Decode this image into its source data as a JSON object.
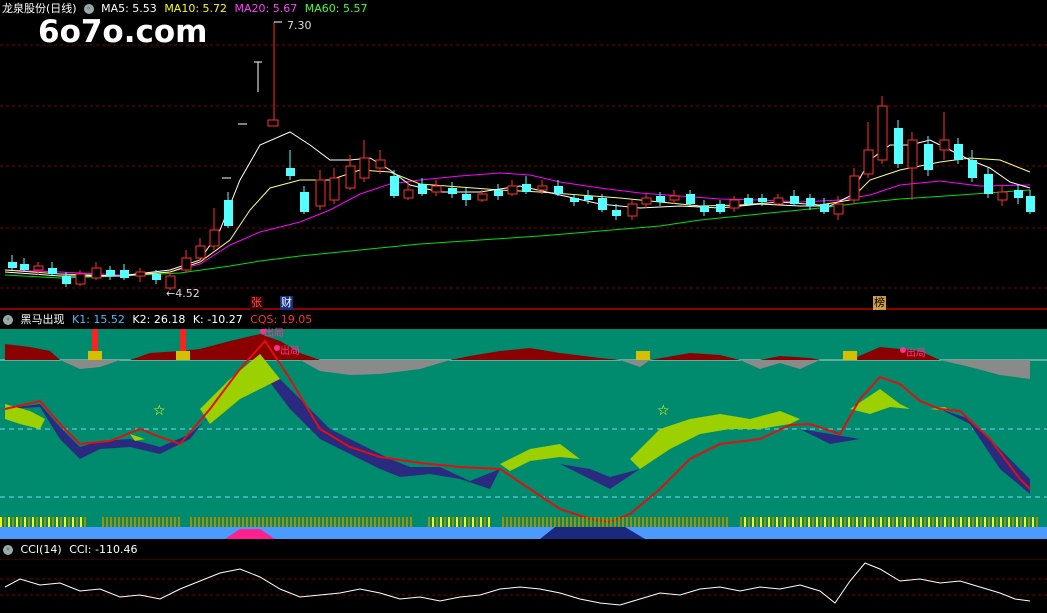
{
  "window_title": "龙泉股份(日线)",
  "watermark": "6o7o.com",
  "main_panel": {
    "indicators": [
      {
        "label": "MA5: 5.53",
        "color": "#ffffff"
      },
      {
        "label": "MA10: 5.72",
        "color": "#ffff00"
      },
      {
        "label": "MA20: 5.67",
        "color": "#ff00ff"
      },
      {
        "label": "MA60: 5.57",
        "color": "#00ff00"
      }
    ],
    "high_label": "7.30",
    "low_label": "4.52",
    "badges": [
      {
        "text": "张",
        "color": "#ff4444",
        "bg": "#400000"
      },
      {
        "text": "财",
        "color": "#ffffff",
        "bg": "#203080"
      },
      {
        "text": "榜",
        "color": "#000000",
        "bg": "#d0a040"
      }
    ]
  },
  "heima_panel": {
    "title": "黑马出现",
    "indicators": [
      {
        "label": "K1: 15.52",
        "color": "#40c0ff"
      },
      {
        "label": "K2: 26.18",
        "color": "#ffffff"
      },
      {
        "label": "K: -10.27",
        "color": "#ffffff"
      },
      {
        "label": "CQS: 19.05",
        "color": "#ff3030"
      }
    ],
    "annotations": [
      "出局",
      "出局",
      "出局"
    ]
  },
  "cci_panel": {
    "title": "CCI(14)",
    "value_label": "CCI: -110.46"
  },
  "colors": {
    "up": "#ff3030",
    "down": "#54ffff",
    "grid": "#8b0000",
    "teal": "#008b6e"
  }
}
